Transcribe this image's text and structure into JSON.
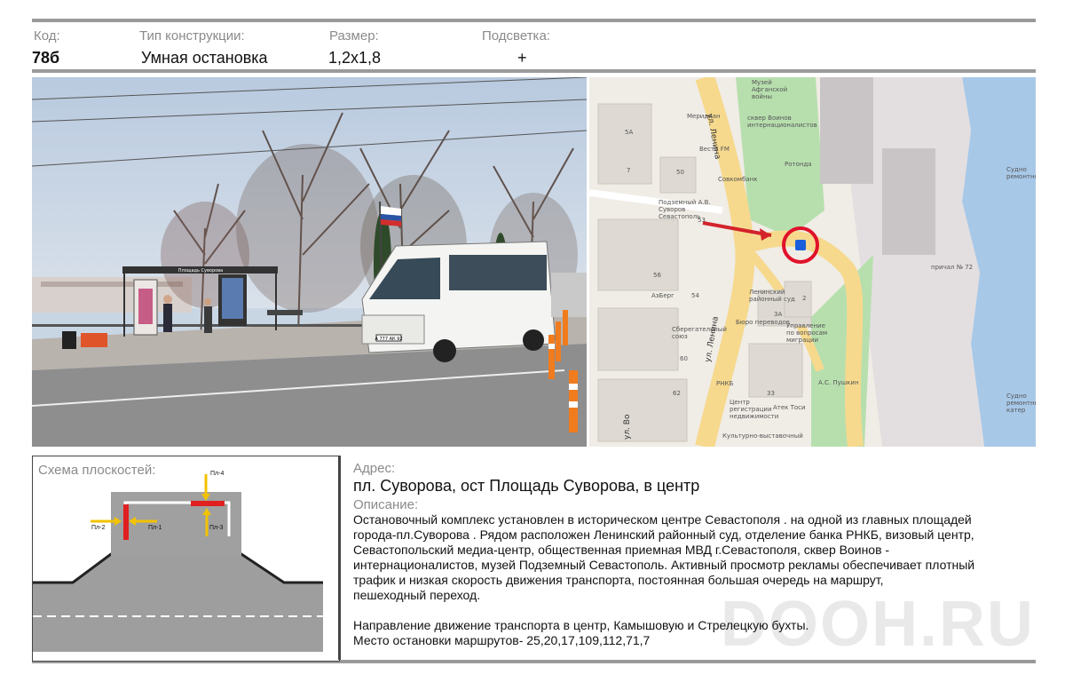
{
  "header": {
    "code_label": "Код:",
    "code_value": "78б",
    "type_label": "Тип конструкции:",
    "type_value": "Умная остановка",
    "size_label": "Размер:",
    "size_value": "1,2х1,8",
    "light_label": "Подсветка:",
    "light_value": "+"
  },
  "photo": {
    "shelter_sign": "Площадь Суворова",
    "bus_plate": "А 777 АК 92"
  },
  "map": {
    "labels": {
      "museum": "Музей Афганской войны",
      "meridian": "Меридиан",
      "street_lenin_1": "ул. Ленина",
      "park": "сквер Воинов интернационалистов",
      "vesti": "Вести FM",
      "rotunda": "Ротонда",
      "sovcom": "Совкомбанк",
      "underground": "Подземный А.В. Суворов Севастополь",
      "num_5a": "5А",
      "num_7": "7",
      "num_50": "50",
      "num_53": "53",
      "num_56": "56",
      "num_54": "54",
      "num_60": "60",
      "num_62": "62",
      "num_33": "33",
      "num_2": "2",
      "num_3a": "3А",
      "azburg": "АзБерг",
      "court": "Ленинский районный суд",
      "bank": "Сберегательный союз",
      "translators": "Бюро переводов",
      "migration": "Управление по вопросам миграции",
      "rnkb": "РНКБ",
      "center": "Центр регистрации недвижимости",
      "atek": "Атек Тоси",
      "pushkin": "А.С. Пушкин",
      "culture": "Культурно-выставочный",
      "street_lenin_2": "ул. Ленина",
      "street_vo": "ул. Во",
      "pier": "причал № 72",
      "sea_label": "Судно ремонтное",
      "sea_label_2": "Судно ремонтный катер"
    }
  },
  "scheme": {
    "title": "Схема плоскостей:",
    "pl1": "Пл-1",
    "pl2": "Пл-2",
    "pl3": "Пл-3",
    "pl4": "Пл-4"
  },
  "info": {
    "address_label": "Адрес:",
    "address": "пл. Суворова, ост Площадь Суворова, в центр",
    "description_label": "Описание:",
    "description_lines": [
      "Остановочный комплекс установлен в историческом центре Севастополя .  на одной из главных площадей",
      "города-пл.Суворова . Рядом расположен Ленинский районный суд, отделение банка РНКБ, визовый центр,",
      "Севастопольский медиа-центр, общественная приемная МВД г.Севастополя,  сквер Воинов -",
      "интернационалистов, музей Подземный Севастополь. Активный просмотр рекламы обеспечивает плотный",
      "трафик и низкая скорость движения транспорта, постоянная большая очередь на маршрут,",
      "пешеходный переход."
    ],
    "direction": "Направление движение транспорта в центр, Камышовую и Стрелецкую бухты.",
    "routes": "Место остановки маршрутов- 25,20,17,109,112,71,7"
  },
  "watermark": "DOOH.RU"
}
